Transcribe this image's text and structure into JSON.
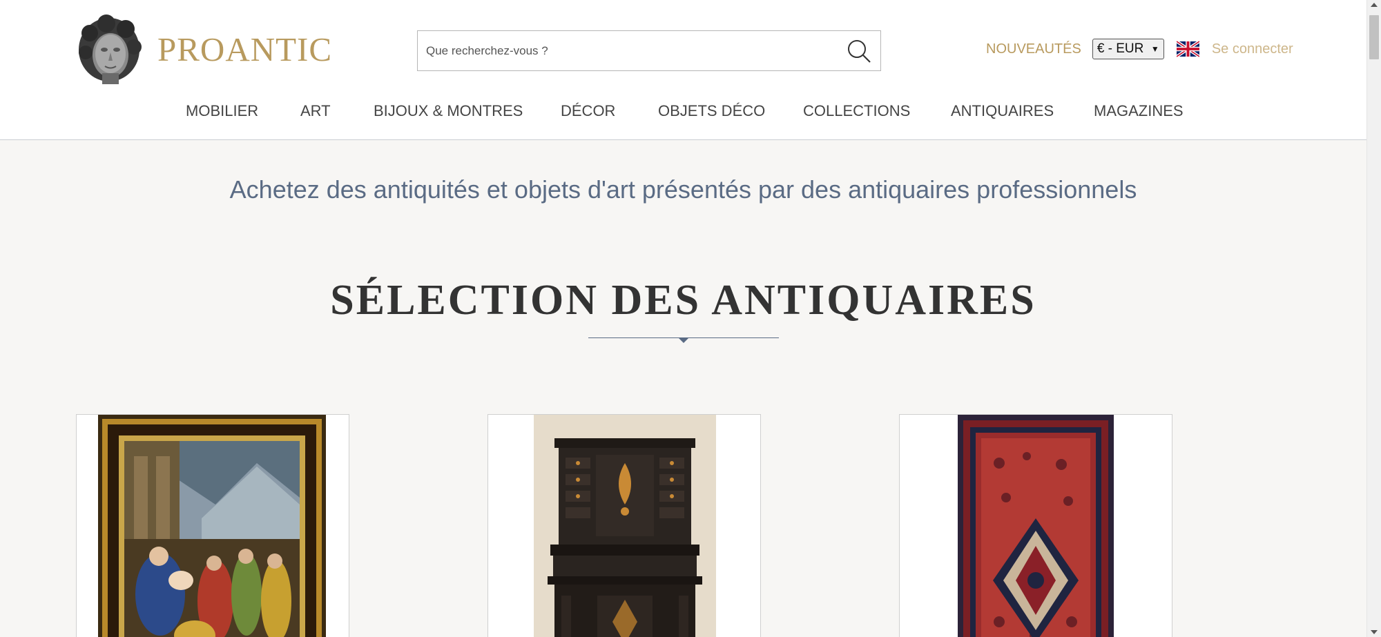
{
  "header": {
    "logo_text": "PROANTIC",
    "search": {
      "placeholder": "Que recherchez-vous ?"
    },
    "new_link": "NOUVEAUTÉS",
    "currency": "€ - EUR",
    "language_icon": "uk-flag-icon",
    "login_link": "Se connecter"
  },
  "nav": {
    "items": [
      {
        "label": "MOBILIER"
      },
      {
        "label": "ART"
      },
      {
        "label": "BIJOUX & MONTRES"
      },
      {
        "label": "DÉCOR"
      },
      {
        "label": "OBJETS DÉCO"
      },
      {
        "label": "COLLECTIONS"
      },
      {
        "label": "ANTIQUAIRES"
      },
      {
        "label": "MAGAZINES"
      }
    ]
  },
  "main": {
    "tagline": "Achetez des antiquités et objets d'art présentés par des antiquaires professionnels",
    "section_title": "SÉLECTION DES ANTIQUAIRES"
  },
  "colors": {
    "brand_gold": "#b89a5e",
    "accent_blue": "#5a6b84",
    "background": "#f7f6f4"
  }
}
